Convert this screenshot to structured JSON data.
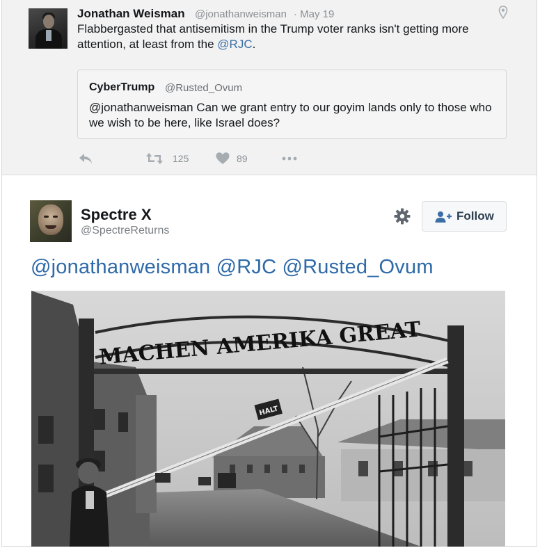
{
  "top_tweet": {
    "author_name": "Jonathan Weisman",
    "author_handle": "@jonathanweisman",
    "date_separator": "·",
    "date": "May 19",
    "text_before": "Flabbergasted that antisemitism in the Trump voter ranks isn't getting more attention, at least from the ",
    "text_mention": "@RJC",
    "text_after": ".",
    "quote": {
      "author_name": "CyberTrump",
      "author_handle": "@Rusted_Ovum",
      "text": "@jonathanweisman Can we grant entry to our goyim lands only to those who we wish to be here, like Israel does?"
    },
    "actions": {
      "reply_icon": "reply-icon",
      "retweet_icon": "retweet-icon",
      "retweet_count": "125",
      "like_icon": "heart-icon",
      "like_count": "89",
      "more_icon": "more-dots-icon"
    }
  },
  "bottom_tweet": {
    "author_name": "Spectre",
    "author_name_symbol": "X",
    "author_handle": "@SpectreReturns",
    "settings_icon": "gear-icon",
    "follow_label": "Follow",
    "follow_icon": "add-user-icon",
    "text": "@jonathanweisman @RJC @Rusted_Ovum",
    "image": {
      "sign_text": "MACHEN AMERIKA GREAT",
      "small_sign": "HALT"
    }
  },
  "colors": {
    "link": "#3a6ea5",
    "top_background": "#f2f2f2",
    "muted_text": "#8a8f94"
  }
}
